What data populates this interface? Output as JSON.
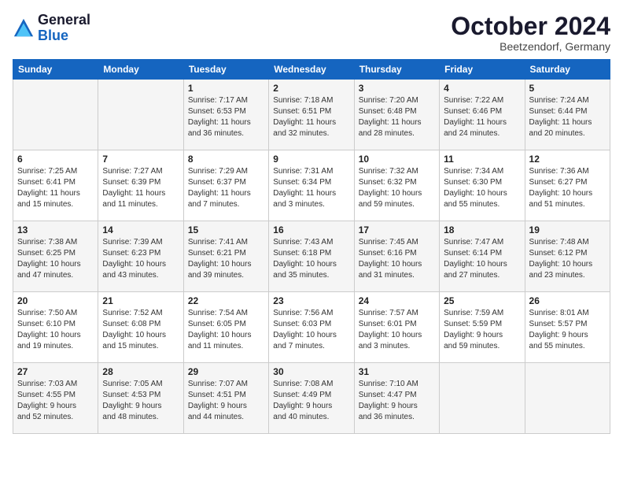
{
  "logo": {
    "line1": "General",
    "line2": "Blue"
  },
  "header": {
    "month_year": "October 2024",
    "location": "Beetzendorf, Germany"
  },
  "days_of_week": [
    "Sunday",
    "Monday",
    "Tuesday",
    "Wednesday",
    "Thursday",
    "Friday",
    "Saturday"
  ],
  "weeks": [
    [
      {
        "day": "",
        "info": ""
      },
      {
        "day": "",
        "info": ""
      },
      {
        "day": "1",
        "info": "Sunrise: 7:17 AM\nSunset: 6:53 PM\nDaylight: 11 hours\nand 36 minutes."
      },
      {
        "day": "2",
        "info": "Sunrise: 7:18 AM\nSunset: 6:51 PM\nDaylight: 11 hours\nand 32 minutes."
      },
      {
        "day": "3",
        "info": "Sunrise: 7:20 AM\nSunset: 6:48 PM\nDaylight: 11 hours\nand 28 minutes."
      },
      {
        "day": "4",
        "info": "Sunrise: 7:22 AM\nSunset: 6:46 PM\nDaylight: 11 hours\nand 24 minutes."
      },
      {
        "day": "5",
        "info": "Sunrise: 7:24 AM\nSunset: 6:44 PM\nDaylight: 11 hours\nand 20 minutes."
      }
    ],
    [
      {
        "day": "6",
        "info": "Sunrise: 7:25 AM\nSunset: 6:41 PM\nDaylight: 11 hours\nand 15 minutes."
      },
      {
        "day": "7",
        "info": "Sunrise: 7:27 AM\nSunset: 6:39 PM\nDaylight: 11 hours\nand 11 minutes."
      },
      {
        "day": "8",
        "info": "Sunrise: 7:29 AM\nSunset: 6:37 PM\nDaylight: 11 hours\nand 7 minutes."
      },
      {
        "day": "9",
        "info": "Sunrise: 7:31 AM\nSunset: 6:34 PM\nDaylight: 11 hours\nand 3 minutes."
      },
      {
        "day": "10",
        "info": "Sunrise: 7:32 AM\nSunset: 6:32 PM\nDaylight: 10 hours\nand 59 minutes."
      },
      {
        "day": "11",
        "info": "Sunrise: 7:34 AM\nSunset: 6:30 PM\nDaylight: 10 hours\nand 55 minutes."
      },
      {
        "day": "12",
        "info": "Sunrise: 7:36 AM\nSunset: 6:27 PM\nDaylight: 10 hours\nand 51 minutes."
      }
    ],
    [
      {
        "day": "13",
        "info": "Sunrise: 7:38 AM\nSunset: 6:25 PM\nDaylight: 10 hours\nand 47 minutes."
      },
      {
        "day": "14",
        "info": "Sunrise: 7:39 AM\nSunset: 6:23 PM\nDaylight: 10 hours\nand 43 minutes."
      },
      {
        "day": "15",
        "info": "Sunrise: 7:41 AM\nSunset: 6:21 PM\nDaylight: 10 hours\nand 39 minutes."
      },
      {
        "day": "16",
        "info": "Sunrise: 7:43 AM\nSunset: 6:18 PM\nDaylight: 10 hours\nand 35 minutes."
      },
      {
        "day": "17",
        "info": "Sunrise: 7:45 AM\nSunset: 6:16 PM\nDaylight: 10 hours\nand 31 minutes."
      },
      {
        "day": "18",
        "info": "Sunrise: 7:47 AM\nSunset: 6:14 PM\nDaylight: 10 hours\nand 27 minutes."
      },
      {
        "day": "19",
        "info": "Sunrise: 7:48 AM\nSunset: 6:12 PM\nDaylight: 10 hours\nand 23 minutes."
      }
    ],
    [
      {
        "day": "20",
        "info": "Sunrise: 7:50 AM\nSunset: 6:10 PM\nDaylight: 10 hours\nand 19 minutes."
      },
      {
        "day": "21",
        "info": "Sunrise: 7:52 AM\nSunset: 6:08 PM\nDaylight: 10 hours\nand 15 minutes."
      },
      {
        "day": "22",
        "info": "Sunrise: 7:54 AM\nSunset: 6:05 PM\nDaylight: 10 hours\nand 11 minutes."
      },
      {
        "day": "23",
        "info": "Sunrise: 7:56 AM\nSunset: 6:03 PM\nDaylight: 10 hours\nand 7 minutes."
      },
      {
        "day": "24",
        "info": "Sunrise: 7:57 AM\nSunset: 6:01 PM\nDaylight: 10 hours\nand 3 minutes."
      },
      {
        "day": "25",
        "info": "Sunrise: 7:59 AM\nSunset: 5:59 PM\nDaylight: 9 hours\nand 59 minutes."
      },
      {
        "day": "26",
        "info": "Sunrise: 8:01 AM\nSunset: 5:57 PM\nDaylight: 9 hours\nand 55 minutes."
      }
    ],
    [
      {
        "day": "27",
        "info": "Sunrise: 7:03 AM\nSunset: 4:55 PM\nDaylight: 9 hours\nand 52 minutes."
      },
      {
        "day": "28",
        "info": "Sunrise: 7:05 AM\nSunset: 4:53 PM\nDaylight: 9 hours\nand 48 minutes."
      },
      {
        "day": "29",
        "info": "Sunrise: 7:07 AM\nSunset: 4:51 PM\nDaylight: 9 hours\nand 44 minutes."
      },
      {
        "day": "30",
        "info": "Sunrise: 7:08 AM\nSunset: 4:49 PM\nDaylight: 9 hours\nand 40 minutes."
      },
      {
        "day": "31",
        "info": "Sunrise: 7:10 AM\nSunset: 4:47 PM\nDaylight: 9 hours\nand 36 minutes."
      },
      {
        "day": "",
        "info": ""
      },
      {
        "day": "",
        "info": ""
      }
    ]
  ]
}
